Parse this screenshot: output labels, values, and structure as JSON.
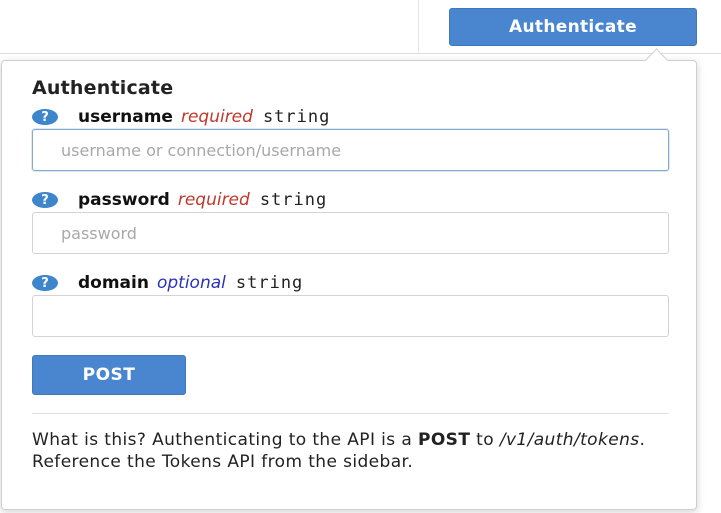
{
  "header": {
    "authenticate_button": "Authenticate"
  },
  "popover": {
    "title": "Authenticate",
    "fields": [
      {
        "help_icon": "question-circle-icon",
        "help_glyph": "?",
        "name": "username",
        "requirement": "required",
        "type": "string",
        "value": "",
        "placeholder": "username or connection/username"
      },
      {
        "help_icon": "question-circle-icon",
        "help_glyph": "?",
        "name": "password",
        "requirement": "required",
        "type": "string",
        "value": "",
        "placeholder": "password"
      },
      {
        "help_icon": "question-circle-icon",
        "help_glyph": "?",
        "name": "domain",
        "requirement": "optional",
        "type": "string",
        "value": "",
        "placeholder": ""
      }
    ],
    "submit_label": "POST",
    "info": {
      "part1": "What is this? Authenticating to the API is a ",
      "method": "POST",
      "part2": " to ",
      "endpoint": "/v1/auth/tokens",
      "part3": ". Reference the Tokens API from the sidebar."
    }
  },
  "colors": {
    "accent": "#4a86cf",
    "required": "#c0392b",
    "optional": "#2a33b8",
    "help_icon": "#3d86cb"
  }
}
